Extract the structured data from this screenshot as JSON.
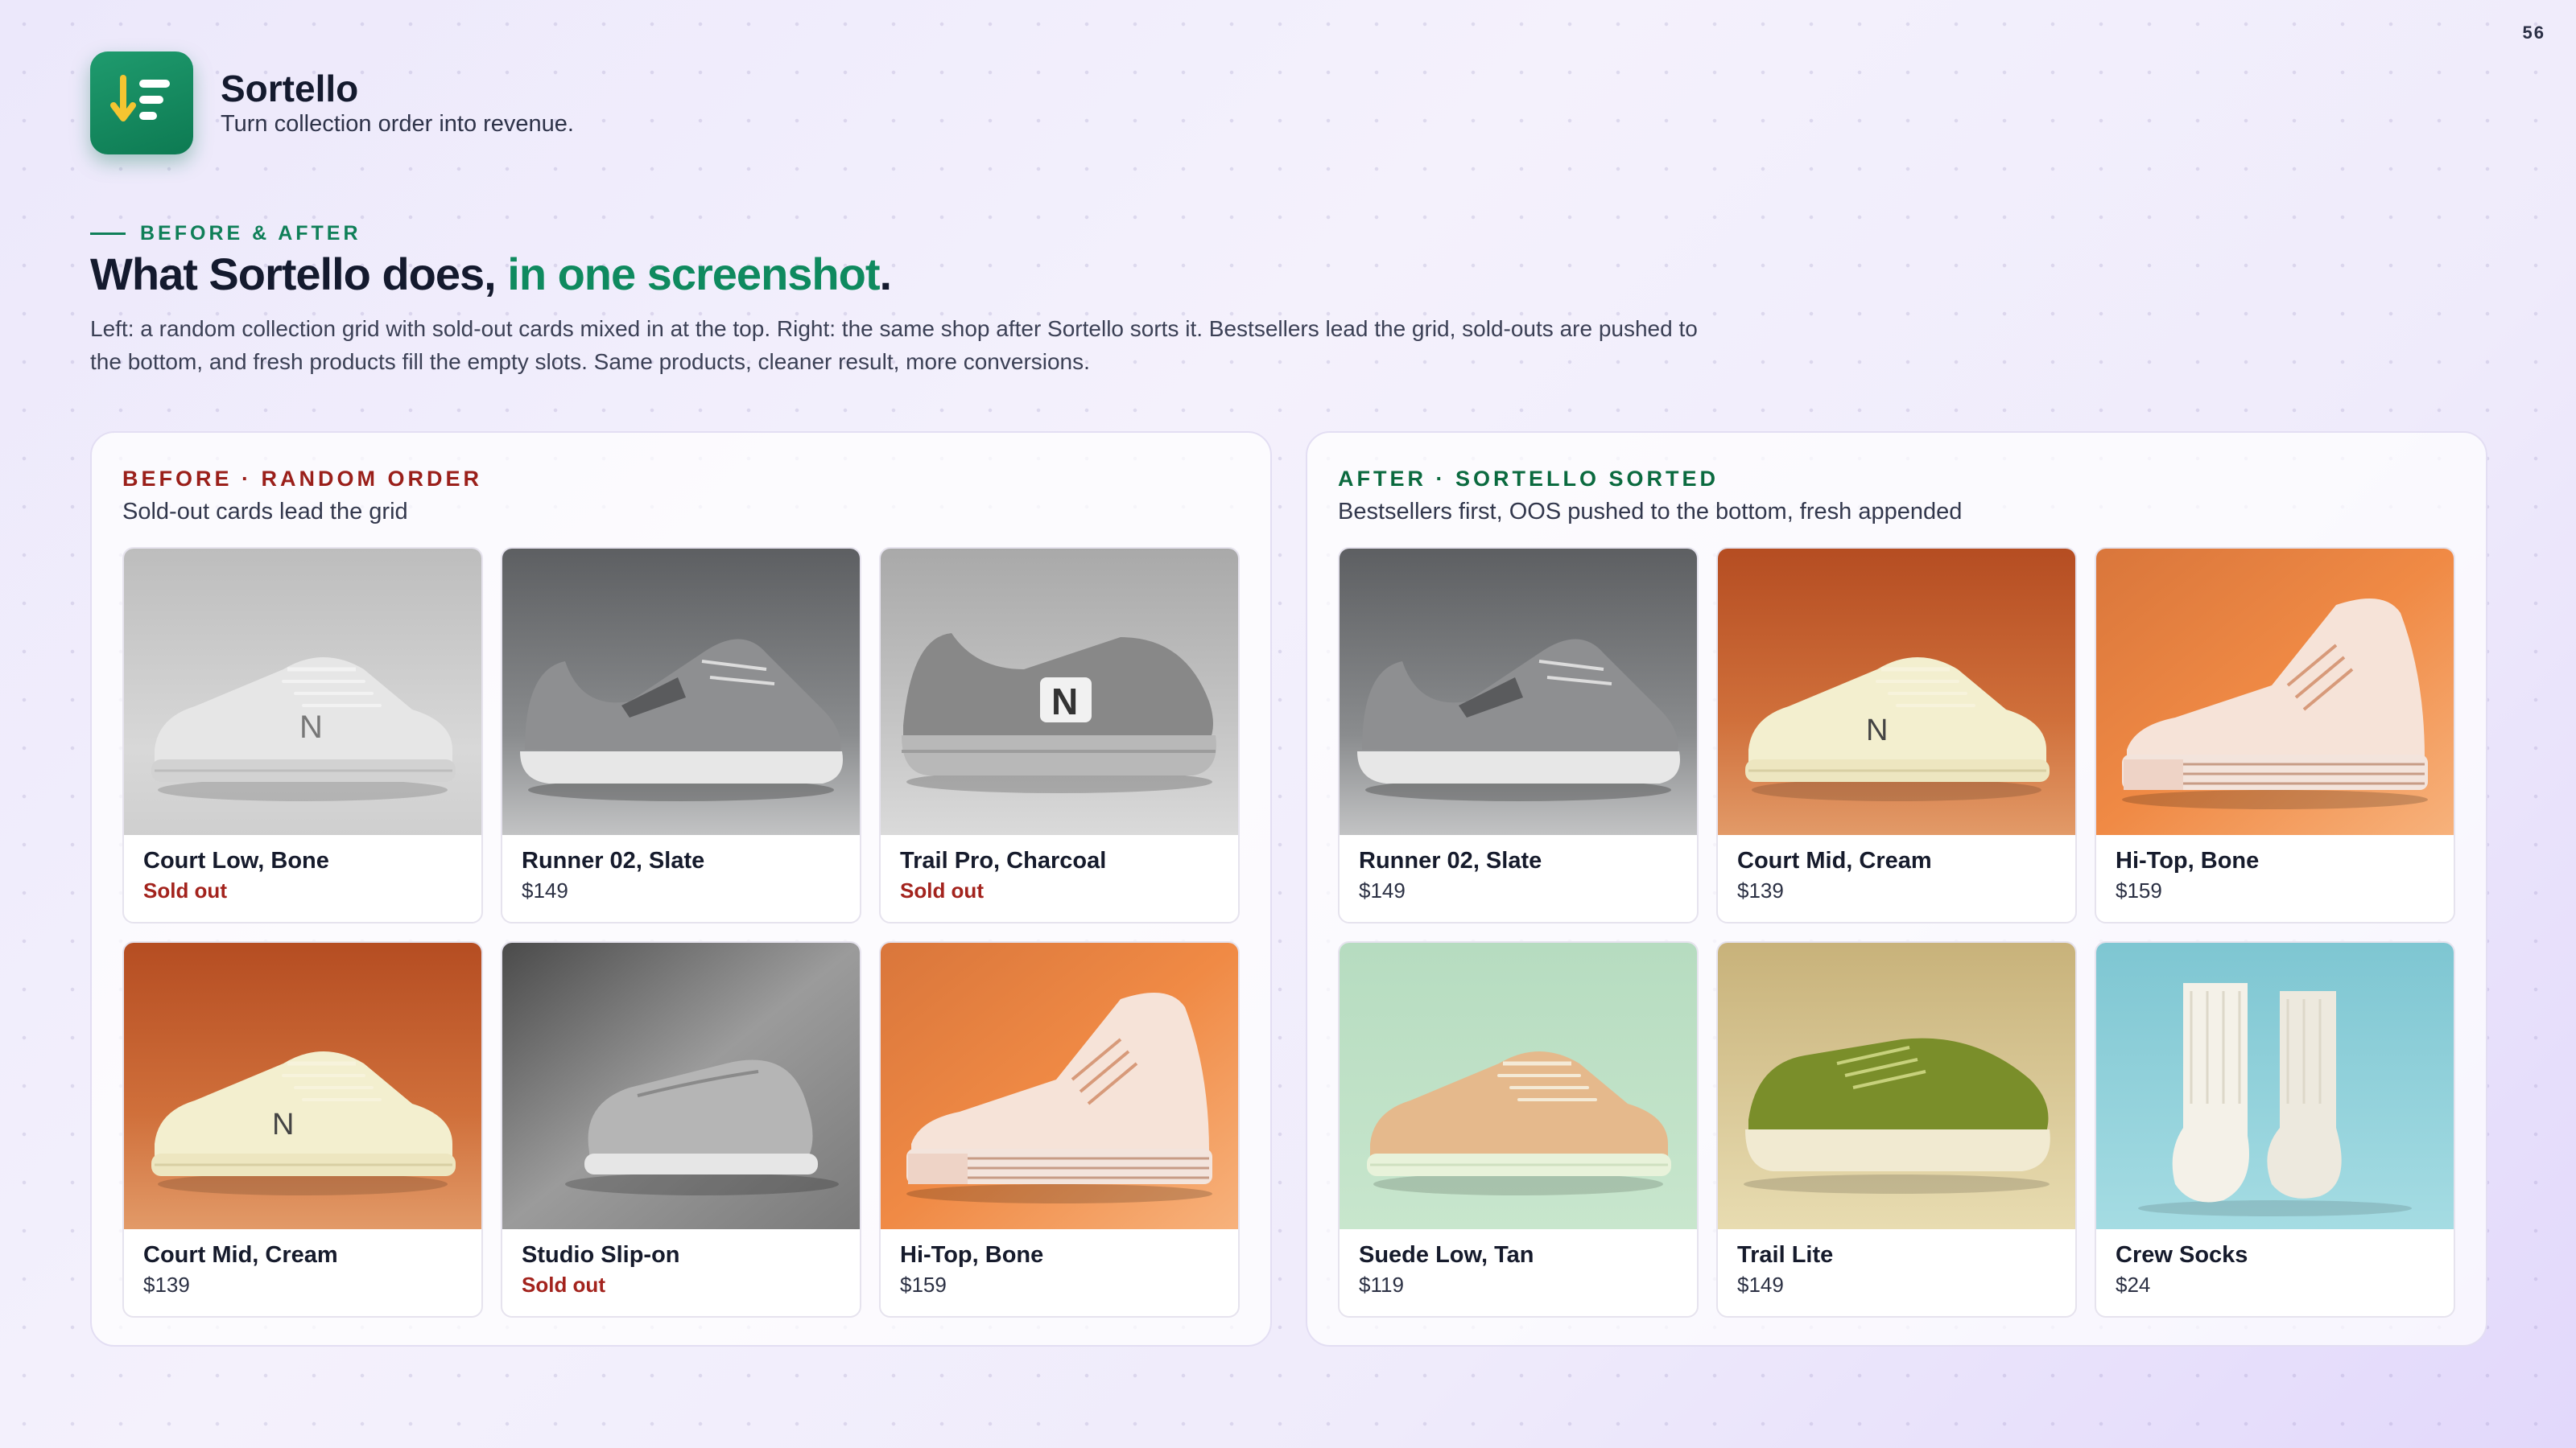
{
  "page_number": "56",
  "brand": {
    "name": "Sortello",
    "tagline": "Turn collection order into revenue."
  },
  "eyebrow": "BEFORE & AFTER",
  "headline": {
    "main": "What Sortello does, ",
    "accent": "in one screenshot",
    "end": "."
  },
  "lede": "Left: a random collection grid with sold-out cards mixed in at the top. Right: the same shop after Sortello sorts it. Bestsellers lead the grid, sold-outs are pushed to the bottom, and fresh products fill the empty slots. Same products, cleaner result, more conversions.",
  "colors": {
    "brand_green": "#0f8a5f",
    "sold_out_red": "#a3231d",
    "after_label_green": "#0b6a3f",
    "before_label_red": "#9a1f1a"
  },
  "before": {
    "label": "BEFORE · RANDOM ORDER",
    "subtitle": "Sold-out cards lead the grid",
    "products": [
      {
        "name": "Court Low, Bone",
        "price": "Sold out",
        "sold_out": true,
        "image": "sneaker-low-gray"
      },
      {
        "name": "Runner 02, Slate",
        "price": "$149",
        "sold_out": false,
        "image": "runner-gray"
      },
      {
        "name": "Trail Pro, Charcoal",
        "price": "Sold out",
        "sold_out": true,
        "image": "trail-gray"
      },
      {
        "name": "Court Mid, Cream",
        "price": "$139",
        "sold_out": false,
        "image": "court-mid-cream"
      },
      {
        "name": "Studio Slip-on",
        "price": "Sold out",
        "sold_out": true,
        "image": "slipon-gray"
      },
      {
        "name": "Hi-Top, Bone",
        "price": "$159",
        "sold_out": false,
        "image": "hitop-orange"
      }
    ]
  },
  "after": {
    "label": "AFTER · SORTELLO SORTED",
    "subtitle": "Bestsellers first, OOS pushed to the bottom, fresh appended",
    "products": [
      {
        "name": "Runner 02, Slate",
        "price": "$149",
        "sold_out": false,
        "image": "runner-gray"
      },
      {
        "name": "Court Mid, Cream",
        "price": "$139",
        "sold_out": false,
        "image": "court-mid-cream"
      },
      {
        "name": "Hi-Top, Bone",
        "price": "$159",
        "sold_out": false,
        "image": "hitop-orange"
      },
      {
        "name": "Suede Low, Tan",
        "price": "$119",
        "sold_out": false,
        "image": "suede-mint"
      },
      {
        "name": "Trail Lite",
        "price": "$149",
        "sold_out": false,
        "image": "trail-olive"
      },
      {
        "name": "Crew Socks",
        "price": "$24",
        "sold_out": false,
        "image": "socks-teal"
      }
    ]
  }
}
